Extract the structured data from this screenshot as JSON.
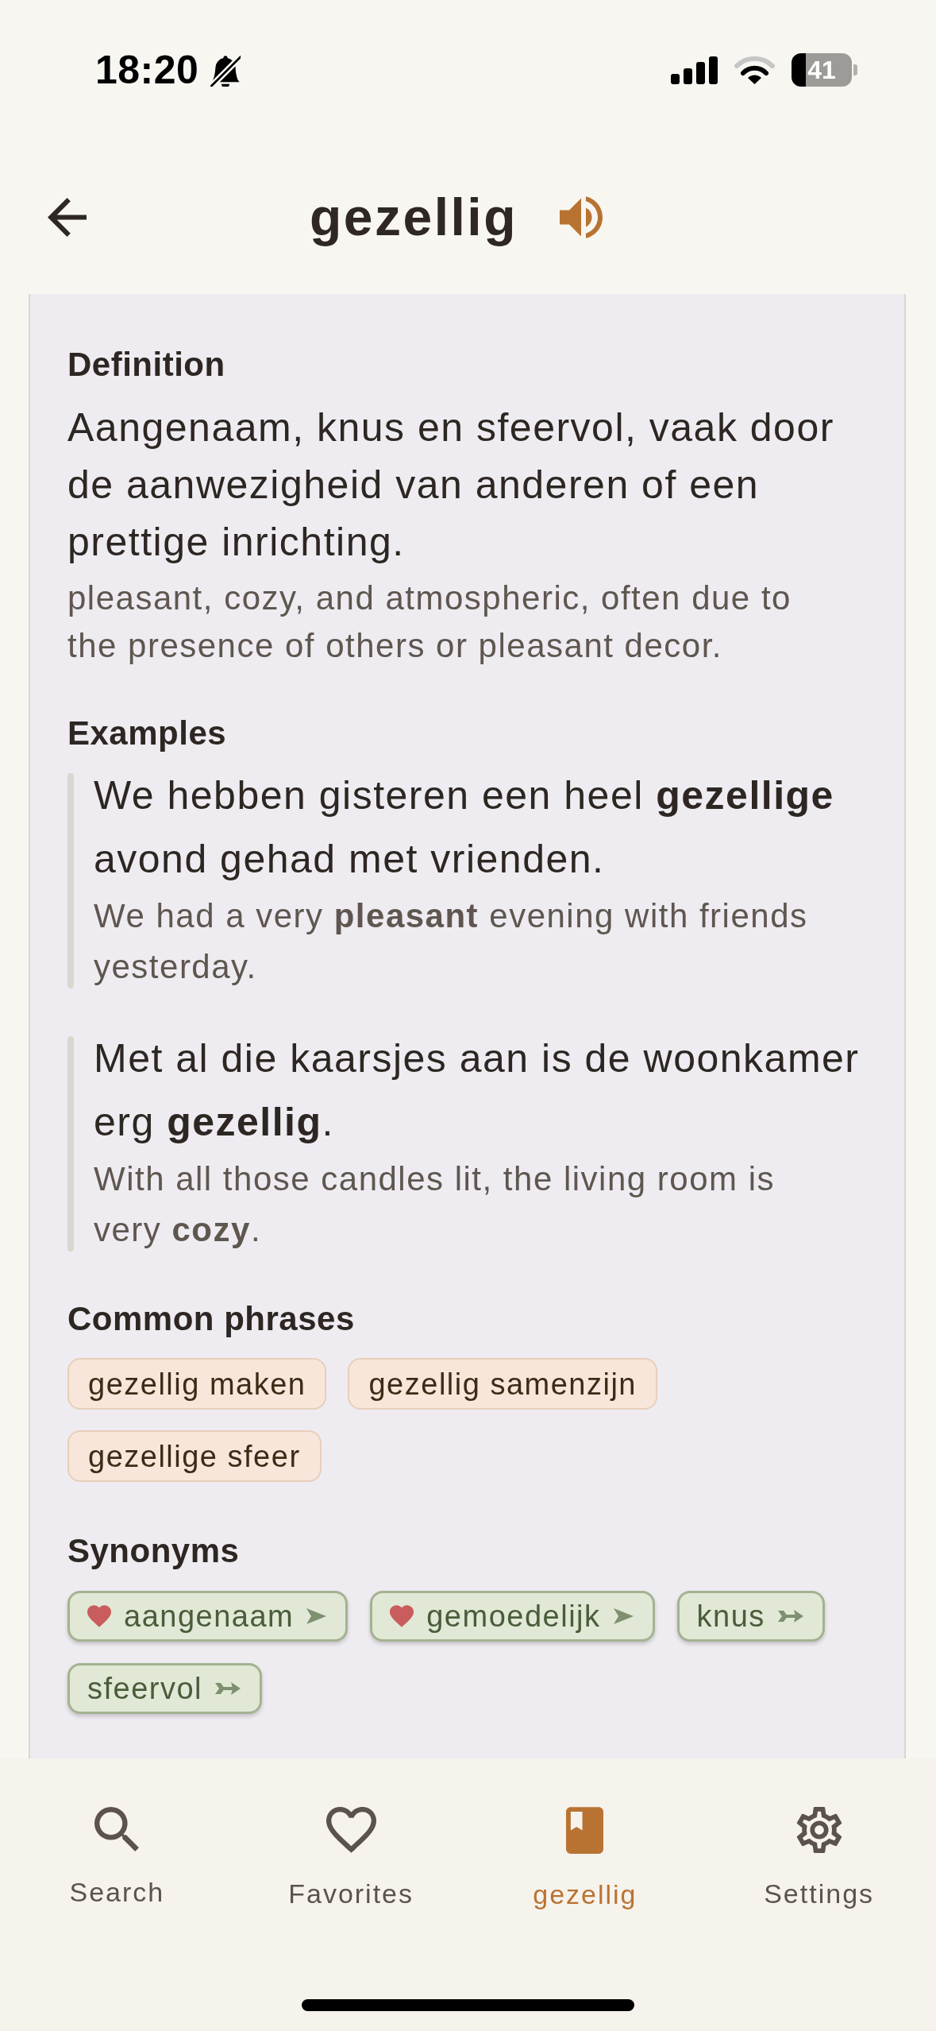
{
  "status_bar": {
    "time": "18:20",
    "silent": true,
    "battery": "41"
  },
  "header": {
    "title": "gezellig"
  },
  "definition": {
    "heading": "Definition",
    "text": "Aangenaam, knus en sfeervol, vaak door de aanwezigheid van anderen of een prettige inrichting.",
    "translation": "pleasant, cozy, and atmospheric, often due to the presence of others or pleasant decor."
  },
  "examples": {
    "heading": "Examples",
    "items": [
      {
        "text": "We hebben gisteren een heel **gezellige** avond gehad met vrienden.",
        "translation": "We had a very **pleasant** evening with friends yesterday."
      },
      {
        "text": "Met al die kaarsjes aan is de woonkamer erg **gezellig**.",
        "translation": "With all those candles lit, the living room is very **cozy**."
      }
    ]
  },
  "common_phrases": {
    "heading": "Common phrases",
    "items": [
      "gezellig maken",
      "gezellig samenzijn",
      "gezellige sfeer"
    ]
  },
  "synonyms": {
    "heading": "Synonyms",
    "items": [
      {
        "word": "aangenaam",
        "favorite": true,
        "kind": "plain"
      },
      {
        "word": "gemoedelijk",
        "favorite": true,
        "kind": "plain"
      },
      {
        "word": "knus",
        "favorite": false,
        "kind": "fletched"
      },
      {
        "word": "sfeervol",
        "favorite": false,
        "kind": "fletched"
      }
    ]
  },
  "tab_bar": {
    "items": [
      {
        "kind": "search",
        "label": "Search",
        "selected": false
      },
      {
        "kind": "favorites",
        "label": "Favorites",
        "selected": false
      },
      {
        "kind": "entry",
        "label": "gezellig",
        "selected": true
      },
      {
        "kind": "settings",
        "label": "Settings",
        "selected": false
      }
    ]
  }
}
